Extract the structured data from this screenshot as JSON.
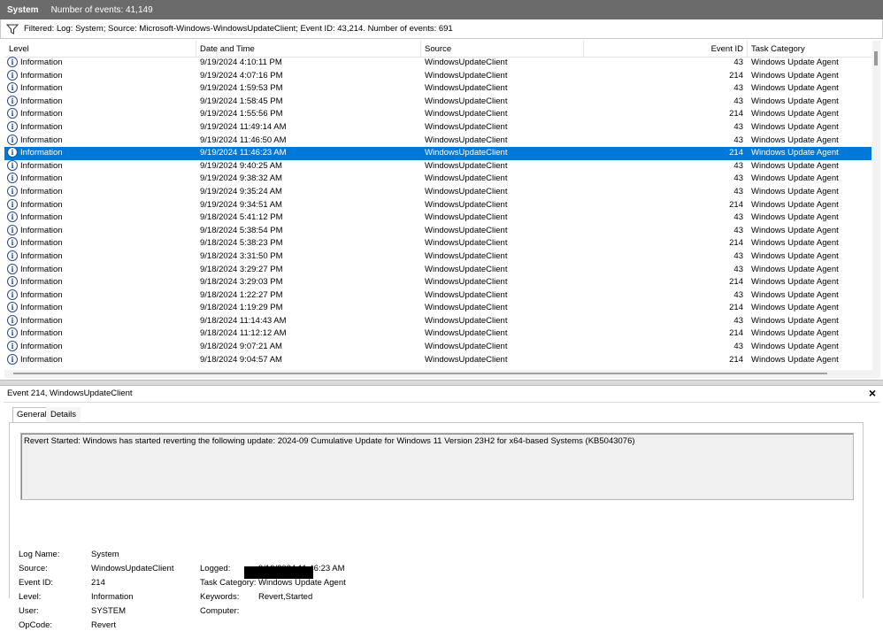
{
  "titlebar": {
    "name": "System",
    "count": "Number of events: 41,149"
  },
  "filter": {
    "text": "Filtered: Log: System; Source: Microsoft-Windows-WindowsUpdateClient; Event ID: 43,214. Number of events: 691"
  },
  "columns": {
    "level": "Level",
    "date": "Date and Time",
    "source": "Source",
    "event_id": "Event ID",
    "task": "Task Category"
  },
  "events": [
    {
      "level": "Information",
      "date": "9/19/2024 4:10:11 PM",
      "source": "WindowsUpdateClient",
      "id": "43",
      "task": "Windows Update Agent"
    },
    {
      "level": "Information",
      "date": "9/19/2024 4:07:16 PM",
      "source": "WindowsUpdateClient",
      "id": "214",
      "task": "Windows Update Agent"
    },
    {
      "level": "Information",
      "date": "9/19/2024 1:59:53 PM",
      "source": "WindowsUpdateClient",
      "id": "43",
      "task": "Windows Update Agent"
    },
    {
      "level": "Information",
      "date": "9/19/2024 1:58:45 PM",
      "source": "WindowsUpdateClient",
      "id": "43",
      "task": "Windows Update Agent"
    },
    {
      "level": "Information",
      "date": "9/19/2024 1:55:56 PM",
      "source": "WindowsUpdateClient",
      "id": "214",
      "task": "Windows Update Agent"
    },
    {
      "level": "Information",
      "date": "9/19/2024 11:49:14 AM",
      "source": "WindowsUpdateClient",
      "id": "43",
      "task": "Windows Update Agent"
    },
    {
      "level": "Information",
      "date": "9/19/2024 11:46:50 AM",
      "source": "WindowsUpdateClient",
      "id": "43",
      "task": "Windows Update Agent"
    },
    {
      "level": "Information",
      "date": "9/19/2024 11:46:23 AM",
      "source": "WindowsUpdateClient",
      "id": "214",
      "task": "Windows Update Agent"
    },
    {
      "level": "Information",
      "date": "9/19/2024 9:40:25 AM",
      "source": "WindowsUpdateClient",
      "id": "43",
      "task": "Windows Update Agent"
    },
    {
      "level": "Information",
      "date": "9/19/2024 9:38:32 AM",
      "source": "WindowsUpdateClient",
      "id": "43",
      "task": "Windows Update Agent"
    },
    {
      "level": "Information",
      "date": "9/19/2024 9:35:24 AM",
      "source": "WindowsUpdateClient",
      "id": "43",
      "task": "Windows Update Agent"
    },
    {
      "level": "Information",
      "date": "9/19/2024 9:34:51 AM",
      "source": "WindowsUpdateClient",
      "id": "214",
      "task": "Windows Update Agent"
    },
    {
      "level": "Information",
      "date": "9/18/2024 5:41:12 PM",
      "source": "WindowsUpdateClient",
      "id": "43",
      "task": "Windows Update Agent"
    },
    {
      "level": "Information",
      "date": "9/18/2024 5:38:54 PM",
      "source": "WindowsUpdateClient",
      "id": "43",
      "task": "Windows Update Agent"
    },
    {
      "level": "Information",
      "date": "9/18/2024 5:38:23 PM",
      "source": "WindowsUpdateClient",
      "id": "214",
      "task": "Windows Update Agent"
    },
    {
      "level": "Information",
      "date": "9/18/2024 3:31:50 PM",
      "source": "WindowsUpdateClient",
      "id": "43",
      "task": "Windows Update Agent"
    },
    {
      "level": "Information",
      "date": "9/18/2024 3:29:27 PM",
      "source": "WindowsUpdateClient",
      "id": "43",
      "task": "Windows Update Agent"
    },
    {
      "level": "Information",
      "date": "9/18/2024 3:29:03 PM",
      "source": "WindowsUpdateClient",
      "id": "214",
      "task": "Windows Update Agent"
    },
    {
      "level": "Information",
      "date": "9/18/2024 1:22:27 PM",
      "source": "WindowsUpdateClient",
      "id": "43",
      "task": "Windows Update Agent"
    },
    {
      "level": "Information",
      "date": "9/18/2024 1:19:29 PM",
      "source": "WindowsUpdateClient",
      "id": "214",
      "task": "Windows Update Agent"
    },
    {
      "level": "Information",
      "date": "9/18/2024 11:14:43 AM",
      "source": "WindowsUpdateClient",
      "id": "43",
      "task": "Windows Update Agent"
    },
    {
      "level": "Information",
      "date": "9/18/2024 11:12:12 AM",
      "source": "WindowsUpdateClient",
      "id": "214",
      "task": "Windows Update Agent"
    },
    {
      "level": "Information",
      "date": "9/18/2024 9:07:21 AM",
      "source": "WindowsUpdateClient",
      "id": "43",
      "task": "Windows Update Agent"
    },
    {
      "level": "Information",
      "date": "9/18/2024 9:04:57 AM",
      "source": "WindowsUpdateClient",
      "id": "214",
      "task": "Windows Update Agent"
    }
  ],
  "selected_index": 7,
  "colors": {
    "selection": "#0078d7",
    "titlebar": "#6b6b6b"
  },
  "icons": {
    "level": "information-icon",
    "filter": "funnel-icon",
    "close": "close-icon"
  },
  "details": {
    "title": "Event 214, WindowsUpdateClient",
    "close": "×",
    "tabs": [
      "General",
      "Details"
    ],
    "description": "Revert Started: Windows has started reverting the following update: 2024-09 Cumulative Update for Windows 11 Version 23H2 for x64-based Systems (KB5043076)",
    "labels": {
      "log_name": "Log Name:",
      "source": "Source:",
      "event_id": "Event ID:",
      "level": "Level:",
      "user": "User:",
      "opcode": "OpCode:",
      "logged": "Logged:",
      "task_category": "Task Category:",
      "keywords": "Keywords:",
      "computer": "Computer:"
    },
    "values": {
      "log_name": "System",
      "source": "WindowsUpdateClient",
      "event_id": "214",
      "level": "Information",
      "user": "SYSTEM",
      "opcode": "Revert",
      "logged": "9/19/2024 11:46:23 AM",
      "task_category": "Windows Update Agent",
      "keywords": "Revert,Started"
    }
  }
}
